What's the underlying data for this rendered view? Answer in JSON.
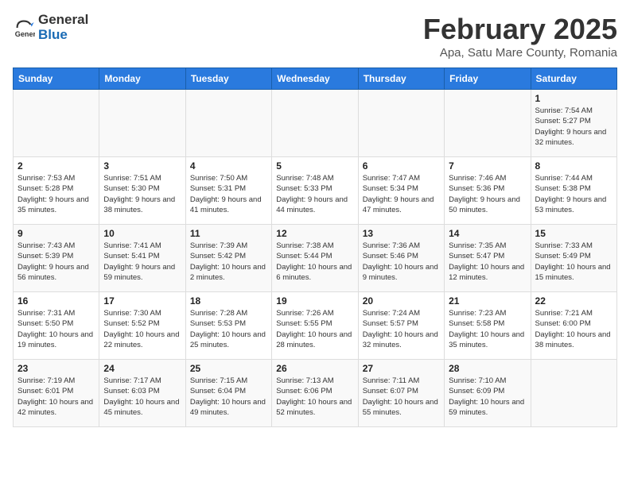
{
  "header": {
    "logo_general": "General",
    "logo_blue": "Blue",
    "month_title": "February 2025",
    "location": "Apa, Satu Mare County, Romania"
  },
  "weekdays": [
    "Sunday",
    "Monday",
    "Tuesday",
    "Wednesday",
    "Thursday",
    "Friday",
    "Saturday"
  ],
  "weeks": [
    [
      {
        "day": "",
        "info": ""
      },
      {
        "day": "",
        "info": ""
      },
      {
        "day": "",
        "info": ""
      },
      {
        "day": "",
        "info": ""
      },
      {
        "day": "",
        "info": ""
      },
      {
        "day": "",
        "info": ""
      },
      {
        "day": "1",
        "info": "Sunrise: 7:54 AM\nSunset: 5:27 PM\nDaylight: 9 hours and 32 minutes."
      }
    ],
    [
      {
        "day": "2",
        "info": "Sunrise: 7:53 AM\nSunset: 5:28 PM\nDaylight: 9 hours and 35 minutes."
      },
      {
        "day": "3",
        "info": "Sunrise: 7:51 AM\nSunset: 5:30 PM\nDaylight: 9 hours and 38 minutes."
      },
      {
        "day": "4",
        "info": "Sunrise: 7:50 AM\nSunset: 5:31 PM\nDaylight: 9 hours and 41 minutes."
      },
      {
        "day": "5",
        "info": "Sunrise: 7:48 AM\nSunset: 5:33 PM\nDaylight: 9 hours and 44 minutes."
      },
      {
        "day": "6",
        "info": "Sunrise: 7:47 AM\nSunset: 5:34 PM\nDaylight: 9 hours and 47 minutes."
      },
      {
        "day": "7",
        "info": "Sunrise: 7:46 AM\nSunset: 5:36 PM\nDaylight: 9 hours and 50 minutes."
      },
      {
        "day": "8",
        "info": "Sunrise: 7:44 AM\nSunset: 5:38 PM\nDaylight: 9 hours and 53 minutes."
      }
    ],
    [
      {
        "day": "9",
        "info": "Sunrise: 7:43 AM\nSunset: 5:39 PM\nDaylight: 9 hours and 56 minutes."
      },
      {
        "day": "10",
        "info": "Sunrise: 7:41 AM\nSunset: 5:41 PM\nDaylight: 9 hours and 59 minutes."
      },
      {
        "day": "11",
        "info": "Sunrise: 7:39 AM\nSunset: 5:42 PM\nDaylight: 10 hours and 2 minutes."
      },
      {
        "day": "12",
        "info": "Sunrise: 7:38 AM\nSunset: 5:44 PM\nDaylight: 10 hours and 6 minutes."
      },
      {
        "day": "13",
        "info": "Sunrise: 7:36 AM\nSunset: 5:46 PM\nDaylight: 10 hours and 9 minutes."
      },
      {
        "day": "14",
        "info": "Sunrise: 7:35 AM\nSunset: 5:47 PM\nDaylight: 10 hours and 12 minutes."
      },
      {
        "day": "15",
        "info": "Sunrise: 7:33 AM\nSunset: 5:49 PM\nDaylight: 10 hours and 15 minutes."
      }
    ],
    [
      {
        "day": "16",
        "info": "Sunrise: 7:31 AM\nSunset: 5:50 PM\nDaylight: 10 hours and 19 minutes."
      },
      {
        "day": "17",
        "info": "Sunrise: 7:30 AM\nSunset: 5:52 PM\nDaylight: 10 hours and 22 minutes."
      },
      {
        "day": "18",
        "info": "Sunrise: 7:28 AM\nSunset: 5:53 PM\nDaylight: 10 hours and 25 minutes."
      },
      {
        "day": "19",
        "info": "Sunrise: 7:26 AM\nSunset: 5:55 PM\nDaylight: 10 hours and 28 minutes."
      },
      {
        "day": "20",
        "info": "Sunrise: 7:24 AM\nSunset: 5:57 PM\nDaylight: 10 hours and 32 minutes."
      },
      {
        "day": "21",
        "info": "Sunrise: 7:23 AM\nSunset: 5:58 PM\nDaylight: 10 hours and 35 minutes."
      },
      {
        "day": "22",
        "info": "Sunrise: 7:21 AM\nSunset: 6:00 PM\nDaylight: 10 hours and 38 minutes."
      }
    ],
    [
      {
        "day": "23",
        "info": "Sunrise: 7:19 AM\nSunset: 6:01 PM\nDaylight: 10 hours and 42 minutes."
      },
      {
        "day": "24",
        "info": "Sunrise: 7:17 AM\nSunset: 6:03 PM\nDaylight: 10 hours and 45 minutes."
      },
      {
        "day": "25",
        "info": "Sunrise: 7:15 AM\nSunset: 6:04 PM\nDaylight: 10 hours and 49 minutes."
      },
      {
        "day": "26",
        "info": "Sunrise: 7:13 AM\nSunset: 6:06 PM\nDaylight: 10 hours and 52 minutes."
      },
      {
        "day": "27",
        "info": "Sunrise: 7:11 AM\nSunset: 6:07 PM\nDaylight: 10 hours and 55 minutes."
      },
      {
        "day": "28",
        "info": "Sunrise: 7:10 AM\nSunset: 6:09 PM\nDaylight: 10 hours and 59 minutes."
      },
      {
        "day": "",
        "info": ""
      }
    ]
  ]
}
